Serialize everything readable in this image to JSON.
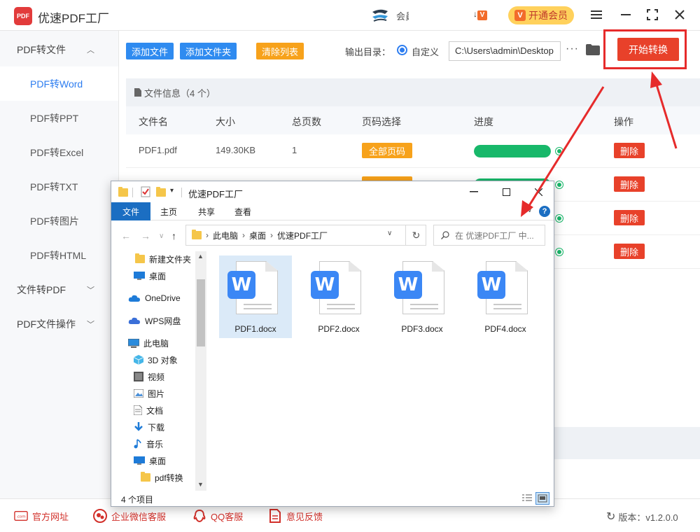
{
  "app": {
    "logo_text": "PDF",
    "title": "优速PDF工厂",
    "member_text": "会員",
    "vip_button": "开通会员",
    "vip_badge": "V"
  },
  "sidebar": {
    "groups": [
      {
        "label": "PDF转文件",
        "chevron": "up"
      },
      {
        "label": "文件转PDF",
        "chevron": "down"
      },
      {
        "label": "PDF文件操作",
        "chevron": "down"
      }
    ],
    "items": [
      {
        "label": "PDF转Word",
        "active": true
      },
      {
        "label": "PDF转PPT"
      },
      {
        "label": "PDF转Excel"
      },
      {
        "label": "PDF转TXT"
      },
      {
        "label": "PDF转图片"
      },
      {
        "label": "PDF转HTML"
      }
    ]
  },
  "toolbar": {
    "add_file": "添加文件",
    "add_folder": "添加文件夹",
    "clear_list": "清除列表",
    "output_label": "输出目录：",
    "custom_label": "自定义",
    "output_path": "C:\\Users\\admin\\Desktop",
    "more": "···",
    "start": "开始转换"
  },
  "file_table": {
    "header": "文件信息（4 个）",
    "columns": [
      "文件名",
      "大小",
      "总页数",
      "页码选择",
      "进度",
      "操作"
    ],
    "rows": [
      {
        "name": "PDF1.pdf",
        "size": "149.30KB",
        "pages": "1",
        "page_select": "全部页码",
        "progress": 1.0,
        "action": "删除"
      },
      {
        "name": "",
        "size": "",
        "pages": "",
        "page_select": "",
        "progress": 1.0,
        "action": "删除"
      },
      {
        "name": "",
        "size": "",
        "pages": "",
        "page_select": "",
        "progress": 1.0,
        "action": "删除"
      },
      {
        "name": "",
        "size": "",
        "pages": "",
        "page_select": "",
        "progress": 1.0,
        "action": "删除"
      }
    ]
  },
  "footer": {
    "website": "官方网址",
    "wechat": "企业微信客服",
    "qq": "QQ客服",
    "feedback": "意见反馈",
    "version": "版本：v1.2.0.0",
    "website_icon_text": ".com"
  },
  "explorer": {
    "title": "优速PDF工厂",
    "tabs": [
      "文件",
      "主页",
      "共享",
      "查看"
    ],
    "breadcrumb": [
      "此电脑",
      "桌面",
      "优速PDF工厂"
    ],
    "search_placeholder": "在 优速PDF工厂 中...",
    "nav_items": [
      {
        "label": "新建文件夹",
        "icon": "folder-icon"
      },
      {
        "label": "桌面",
        "icon": "desktop-icon"
      },
      {
        "label": "OneDrive",
        "icon": "cloud-icon"
      },
      {
        "label": "WPS网盘",
        "icon": "cloud-icon"
      },
      {
        "label": "此电脑",
        "icon": "computer-icon"
      },
      {
        "label": "3D 对象",
        "icon": "cube-icon"
      },
      {
        "label": "视频",
        "icon": "video-icon"
      },
      {
        "label": "图片",
        "icon": "picture-icon"
      },
      {
        "label": "文档",
        "icon": "document-icon"
      },
      {
        "label": "下载",
        "icon": "download-icon"
      },
      {
        "label": "音乐",
        "icon": "music-icon"
      },
      {
        "label": "桌面",
        "icon": "desktop-icon"
      },
      {
        "label": "pdf转换",
        "icon": "folder-icon"
      }
    ],
    "files": [
      "PDF1.docx",
      "PDF2.docx",
      "PDF3.docx",
      "PDF4.docx"
    ],
    "status": "4 个项目",
    "w_letter": "W"
  },
  "colors": {
    "accent_blue": "#2f8bf0",
    "orange": "#f7a21b",
    "red": "#e8412a",
    "green": "#18b86a",
    "annotation_red": "#e62b2b"
  }
}
